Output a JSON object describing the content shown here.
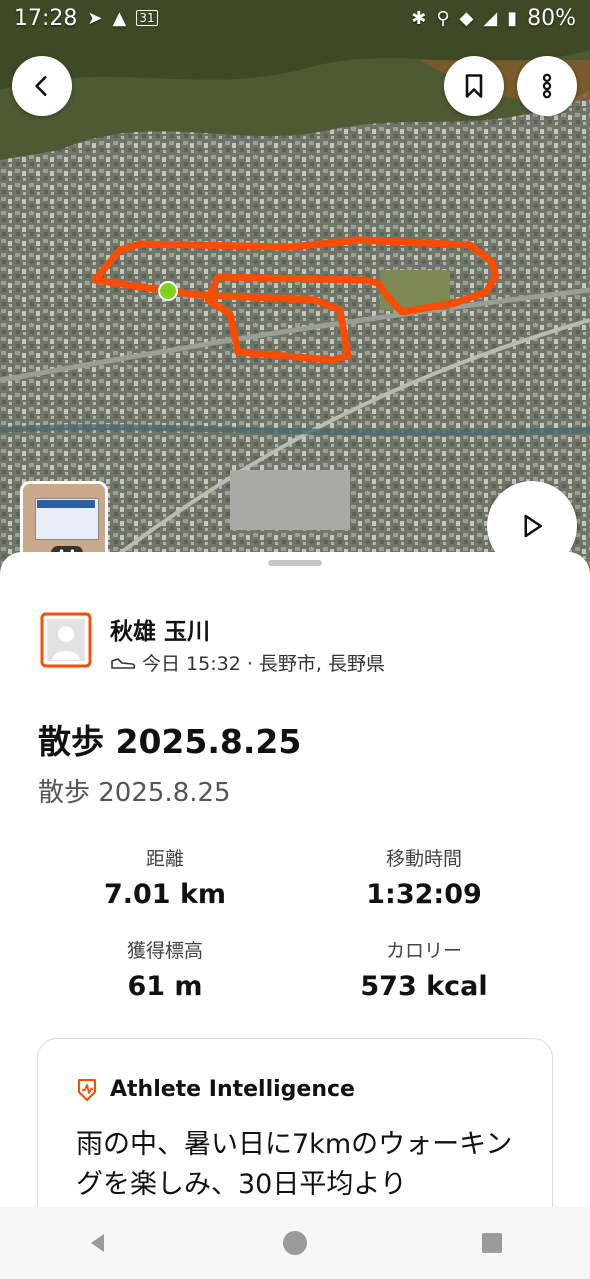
{
  "status_bar": {
    "time": "17:28",
    "battery": "80%",
    "icons": [
      "navigation-icon",
      "warning-icon",
      "calendar-icon",
      "bluetooth-icon",
      "location-icon",
      "wifi-icon",
      "signal-icon",
      "battery-icon"
    ],
    "calendar_day": "31"
  },
  "map": {
    "route_color": "#fc4c02",
    "start_marker_color": "#7ed321",
    "icons": {
      "back": "back-arrow-icon",
      "bookmark": "bookmark-icon",
      "more": "more-vertical-icon",
      "play": "play-icon"
    },
    "thumbnail_badge": "• •"
  },
  "activity": {
    "athlete_name": "秋雄 玉川",
    "meta": "今日 15:32 · 長野市, 長野県",
    "title": "散歩 2025.8.25",
    "description": "散歩 2025.8.25",
    "stats": [
      {
        "label": "距離",
        "value": "7.01 km"
      },
      {
        "label": "移動時間",
        "value": "1:32:09"
      },
      {
        "label": "獲得標高",
        "value": "61 m"
      },
      {
        "label": "カロリー",
        "value": "573 kcal"
      }
    ]
  },
  "athlete_intelligence": {
    "title": "Athlete Intelligence",
    "text": "雨の中、暑い日に7kmのウォーキングを楽しみ、30日平均より"
  },
  "colors": {
    "accent": "#fc4c02"
  }
}
